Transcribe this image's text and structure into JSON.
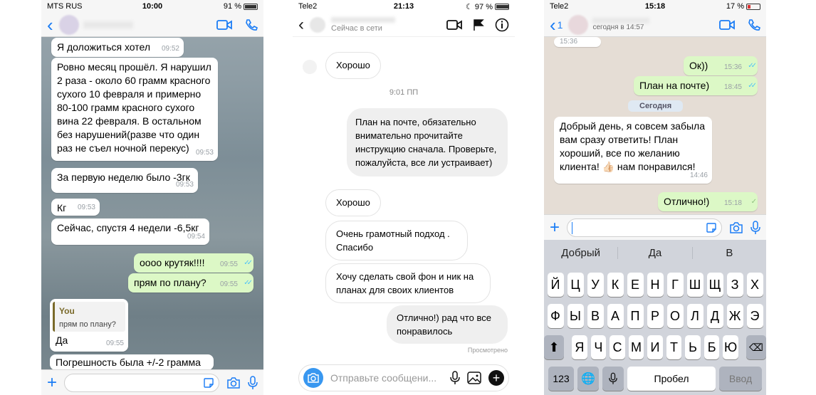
{
  "phone1": {
    "status": {
      "carrier": "MTS RUS",
      "time": "10:00",
      "battery": "91 %"
    },
    "messages": [
      {
        "text": "Я доложиться хотел",
        "time": "09:52",
        "dir": "in"
      },
      {
        "text": "Ровно месяц прошёл. Я нарушил 2 раза - около 60 грамм красного сухого 10 февраля и примерно 80-100 грамм красного сухого вина 22 февраля. В остальном без нарушений(разве что один раз не съел ночной перекус)",
        "time": "09:53",
        "dir": "in"
      },
      {
        "text": "За первую неделю было -3гк",
        "time": "09:53",
        "dir": "in"
      },
      {
        "text": "Кг",
        "time": "09:53",
        "dir": "in"
      },
      {
        "text": "Сейчас, спустя 4 недели -6,5кг",
        "time": "09:54",
        "dir": "in"
      },
      {
        "text": "оооо крутяк!!!!",
        "time": "09:55",
        "dir": "out"
      },
      {
        "text": "прям по плану?",
        "time": "09:55",
        "dir": "out"
      },
      {
        "text": "Да",
        "time": "09:55",
        "dir": "in"
      },
      {
        "text": "Погрешность была +/-2 грамма",
        "time": "",
        "dir": "in"
      }
    ],
    "quote": {
      "author": "You",
      "text": "прям по плану?"
    }
  },
  "phone2": {
    "status": {
      "carrier": "Tele2",
      "time": "21:13",
      "battery": "97 %"
    },
    "online": "Сейчас в сети",
    "time_sep": "9:01 ПП",
    "messages": [
      {
        "text": "Хорошо",
        "dir": "in"
      },
      {
        "text": "План на почте, обязательно внимательно прочитайте инструкцию сначала. Проверьте, пожалуйста, все ли устраивает)",
        "dir": "out"
      },
      {
        "text": "Хорошо",
        "dir": "in"
      },
      {
        "text": "Очень грамотный подход . Спасибо",
        "dir": "in"
      },
      {
        "text": "Хочу сделать свой фон и ник на планах для своих клиентов",
        "dir": "in"
      },
      {
        "text": "Отлично!) рад что все понравилось",
        "dir": "out"
      }
    ],
    "seen": "Просмотрено",
    "input_placeholder": "Отправьте сообщени..."
  },
  "phone3": {
    "status": {
      "carrier": "Tele2",
      "time": "15:18",
      "battery": "17 %"
    },
    "back_count": "1",
    "last_seen": "сегодня в 14:57",
    "top_time": "15:36",
    "messages": [
      {
        "text": "Ок))",
        "time": "15:36",
        "dir": "out"
      },
      {
        "text": "План на почте)",
        "time": "18:45",
        "dir": "out"
      },
      {
        "text": "Добрый день, я совсем забыла вам сразу ответить! План хороший, все по желанию клиента! 👍🏻 нам понравился!",
        "time": "14:46",
        "dir": "in"
      },
      {
        "text": "Отлично!)",
        "time": "15:18",
        "dir": "out"
      }
    ],
    "date_chip": "Сегодня",
    "suggestions": [
      "Добрый",
      "Да",
      "В"
    ],
    "rows": [
      [
        "Й",
        "Ц",
        "У",
        "К",
        "Е",
        "Н",
        "Г",
        "Ш",
        "Щ",
        "З",
        "Х"
      ],
      [
        "Ф",
        "Ы",
        "В",
        "А",
        "П",
        "Р",
        "О",
        "Л",
        "Д",
        "Ж",
        "Э"
      ],
      [
        "Я",
        "Ч",
        "С",
        "М",
        "И",
        "Т",
        "Ь",
        "Б",
        "Ю"
      ]
    ],
    "key_123": "123",
    "key_space": "Пробел",
    "key_enter": "Ввод"
  },
  "colors": {
    "wa_out": "#dcf8c6",
    "ios_blue": "#1a7cf5",
    "ig_out": "#efefef"
  }
}
